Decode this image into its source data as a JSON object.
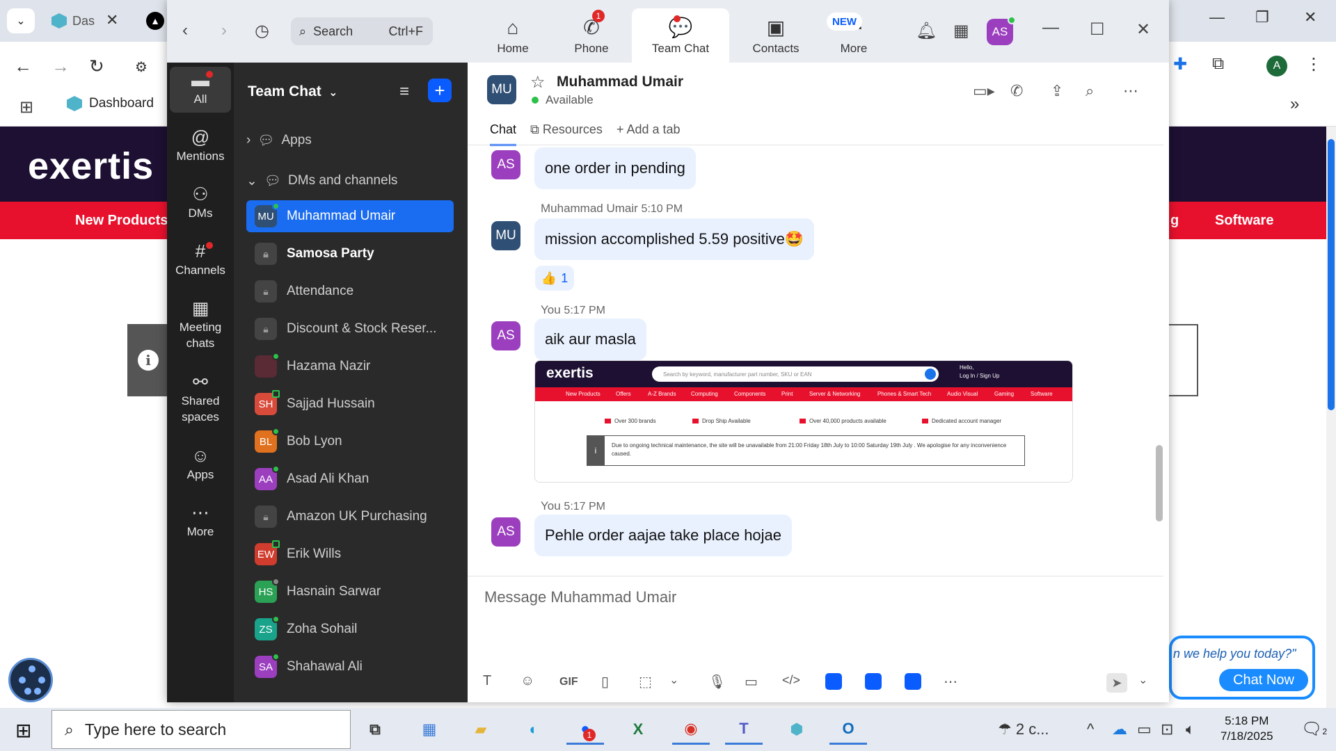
{
  "browser": {
    "tab_title": "Das",
    "bookmark_dashboard": "Dashboard",
    "site_logo": "exertis",
    "nav_left": "New Products",
    "nav_right_partial": "g",
    "nav_right": "Software",
    "chat_widget_question": "n we help you today?\"",
    "chat_widget_button": "Chat Now",
    "profile_initial": "A"
  },
  "zoom": {
    "search_label": "Search",
    "search_shortcut": "Ctrl+F",
    "nav": [
      {
        "label": "Home",
        "icon": "home-icon"
      },
      {
        "label": "Phone",
        "icon": "phone-icon",
        "badge": "1"
      },
      {
        "label": "Team Chat",
        "icon": "team-chat-icon"
      },
      {
        "label": "Contacts",
        "icon": "contacts-icon"
      },
      {
        "label": "More",
        "icon": "more-icon"
      }
    ],
    "new_badge": "NEW",
    "user_initials": "AS"
  },
  "rail": {
    "items": [
      {
        "label": "All"
      },
      {
        "label": "Mentions"
      },
      {
        "label": "DMs"
      },
      {
        "label": "Channels"
      },
      {
        "label": "Meeting chats"
      },
      {
        "label": "Shared spaces"
      },
      {
        "label": "Apps"
      },
      {
        "label": "More"
      }
    ]
  },
  "list": {
    "title": "Team Chat",
    "sections": [
      "Apps",
      "DMs and channels"
    ],
    "rows": [
      {
        "name": "Muhammad Umair",
        "initials": "MU",
        "color": "#2f4f74"
      },
      {
        "name": "Samosa Party",
        "initials": "",
        "color": "#444"
      },
      {
        "name": "Attendance",
        "initials": "",
        "color": "#444"
      },
      {
        "name": "Discount & Stock Reser...",
        "initials": "",
        "color": "#444"
      },
      {
        "name": "Hazama Nazir",
        "initials": "",
        "color": "#5a2a35"
      },
      {
        "name": "Sajjad Hussain",
        "initials": "SH",
        "color": "#d84a3a"
      },
      {
        "name": "Bob Lyon",
        "initials": "BL",
        "color": "#e0711f"
      },
      {
        "name": "Asad Ali Khan",
        "initials": "AA",
        "color": "#9b3fbf"
      },
      {
        "name": "Amazon UK Purchasing",
        "initials": "",
        "color": "#444"
      },
      {
        "name": "Erik Wills",
        "initials": "EW",
        "color": "#d03c2e"
      },
      {
        "name": "Hasnain Sarwar",
        "initials": "HS",
        "color": "#2aa154"
      },
      {
        "name": "Zoha Sohail",
        "initials": "ZS",
        "color": "#19a38a"
      },
      {
        "name": "Shahawal Ali",
        "initials": "SA",
        "color": "#9b3fbf"
      }
    ]
  },
  "chat": {
    "header_initials": "MU",
    "header_name": "Muhammad Umair",
    "header_status": "Available",
    "tabs": [
      "Chat",
      "Resources",
      "Add a tab"
    ],
    "messages": [
      {
        "sender": "",
        "time": "",
        "initials": "AS",
        "text": "one order in pending"
      },
      {
        "sender": "Muhammad Umair",
        "time": "5:10 PM",
        "initials": "MU",
        "text": "mission accomplished 5.59 positive🤩",
        "reaction": "👍",
        "reaction_count": "1"
      },
      {
        "sender": "You",
        "time": "5:17 PM",
        "initials": "AS",
        "text": "aik aur masla"
      },
      {
        "sender": "You",
        "time": "5:17 PM",
        "initials": "AS",
        "text": "Pehle order aajae take place hojae"
      }
    ],
    "screenshot": {
      "logo": "exertis",
      "search_placeholder": "Search by keyword, manufacturer part number, SKU or EAN",
      "login_line1": "Hello,",
      "login_line2": "Log In / Sign Up",
      "nav": [
        "New Products",
        "Offers",
        "A-Z Brands",
        "Computing",
        "Components",
        "Print",
        "Server & Networking",
        "Phones & Smart Tech",
        "Audio Visual",
        "Gaming",
        "Software"
      ],
      "features": [
        "Over 300 brands",
        "Drop Ship Available",
        "Over 40,000 products available",
        "Dedicated account manager"
      ],
      "notice": "Due to ongoing technical maintenance, the site will be unavailable from 21:00 Friday 18th July to 10:00 Saturday 19th July . We apologise for any inconvenience caused."
    },
    "compose_placeholder": "Message Muhammad Umair",
    "compose_gif": "GIF"
  },
  "taskbar": {
    "search_placeholder": "Type here to search",
    "weather": "2 c...",
    "time": "5:18 PM",
    "date": "7/18/2025",
    "notif_count": "2",
    "zoom_badge": "1"
  }
}
